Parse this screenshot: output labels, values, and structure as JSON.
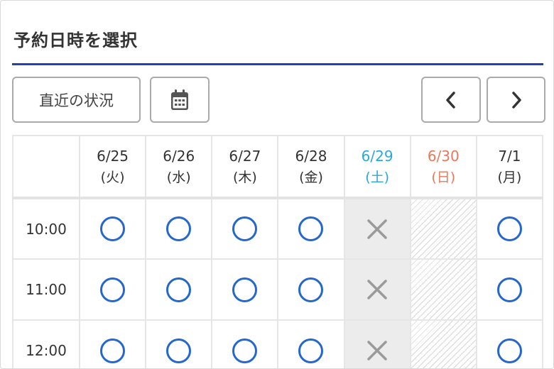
{
  "title": "予約日時を選択",
  "toolbar": {
    "recent_label": "直近の状況",
    "calendar_icon": "calendar-icon",
    "prev_icon": "chevron-left-icon",
    "next_icon": "chevron-right-icon"
  },
  "colors": {
    "accent": "#2240b8",
    "available": "#2567cc",
    "saturday": "#2aa8d8",
    "sunday": "#e8785c"
  },
  "dates": [
    {
      "date": "6/25",
      "weekday": "(火)"
    },
    {
      "date": "6/26",
      "weekday": "(水)"
    },
    {
      "date": "6/27",
      "weekday": "(木)"
    },
    {
      "date": "6/28",
      "weekday": "(金)"
    },
    {
      "date": "6/29",
      "weekday": "(土)"
    },
    {
      "date": "6/30",
      "weekday": "(日)"
    },
    {
      "date": "7/1",
      "weekday": "(月)"
    }
  ],
  "slots": [
    {
      "time": "10:00",
      "status": [
        "available",
        "available",
        "available",
        "available",
        "full",
        "closed",
        "available"
      ]
    },
    {
      "time": "11:00",
      "status": [
        "available",
        "available",
        "available",
        "available",
        "full",
        "closed",
        "available"
      ]
    },
    {
      "time": "12:00",
      "status": [
        "available",
        "available",
        "available",
        "available",
        "full",
        "closed",
        "available"
      ]
    }
  ]
}
